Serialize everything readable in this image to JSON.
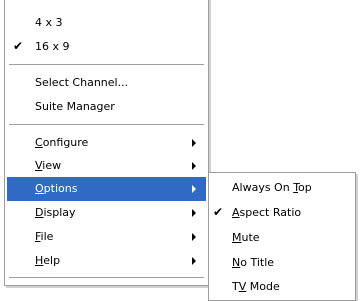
{
  "main_menu": {
    "items": [
      {
        "label": "4 x 3",
        "checked": false
      },
      {
        "label": "16 x 9",
        "checked": true
      },
      {
        "label": "Select Channel..."
      },
      {
        "label": "Suite Manager"
      },
      {
        "pre": "",
        "key": "C",
        "post": "onfigure",
        "submenu": true
      },
      {
        "pre": "",
        "key": "V",
        "post": "iew",
        "submenu": true
      },
      {
        "pre": "",
        "key": "O",
        "post": "ptions",
        "submenu": true,
        "highlighted": true
      },
      {
        "pre": "",
        "key": "D",
        "post": "isplay",
        "submenu": true
      },
      {
        "pre": "",
        "key": "F",
        "post": "ile",
        "submenu": true
      },
      {
        "pre": "",
        "key": "H",
        "post": "elp",
        "submenu": true
      }
    ]
  },
  "options_submenu": {
    "items": [
      {
        "pre": "Always On ",
        "key": "T",
        "post": "op",
        "checked": false
      },
      {
        "pre": "",
        "key": "A",
        "post": "spect Ratio",
        "checked": true
      },
      {
        "pre": "",
        "key": "M",
        "post": "ute",
        "checked": false
      },
      {
        "pre": "",
        "key": "N",
        "post": "o Title",
        "checked": false
      },
      {
        "pre": "T",
        "key": "V",
        "post": " Mode",
        "checked": false
      }
    ]
  },
  "check_glyph": "✔",
  "highlight_color": "#316ac5"
}
